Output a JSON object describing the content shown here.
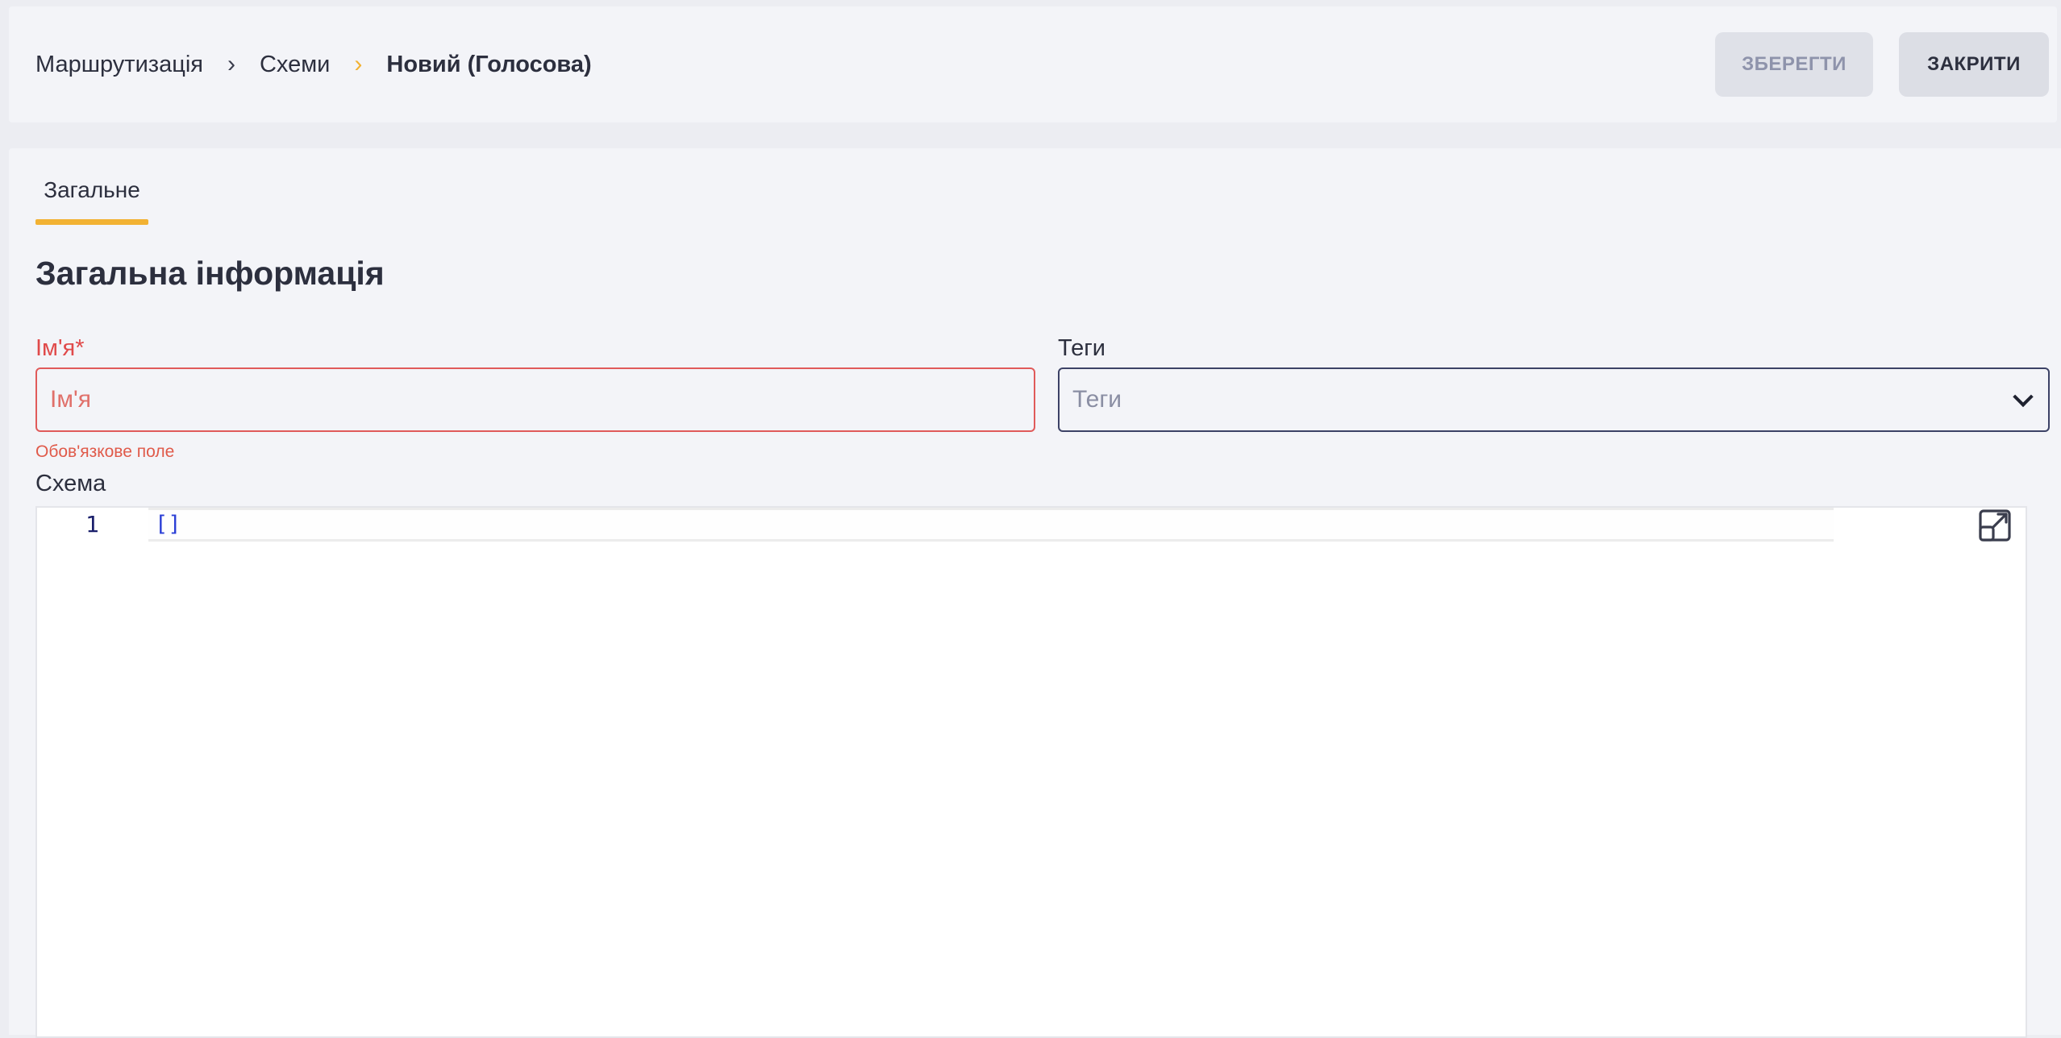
{
  "breadcrumb": {
    "items": [
      "Маршрутизація",
      "Схеми"
    ],
    "current": "Новий (Голосова)",
    "separator": "›"
  },
  "toolbar": {
    "save_label": "ЗБЕРЕГТИ",
    "close_label": "ЗАКРИТИ"
  },
  "tabs": [
    {
      "label": "Загальне",
      "active": true
    }
  ],
  "section": {
    "title": "Загальна інформація"
  },
  "form": {
    "name": {
      "label": "Ім'я*",
      "placeholder": "Ім'я",
      "error": "Обов'язкове поле"
    },
    "tags": {
      "label": "Теги",
      "placeholder": "Теги"
    },
    "schema": {
      "label": "Схема",
      "line_number": "1",
      "code": "[]"
    }
  },
  "colors": {
    "accent": "#f2b233",
    "error": "#e05a5a",
    "text": "#2c2f3e",
    "code": "#2b3fd6"
  },
  "icons": {
    "breadcrumb_separator": "chevron-right-icon",
    "tags_dropdown": "chevron-down-icon",
    "editor_expand": "expand-icon"
  }
}
